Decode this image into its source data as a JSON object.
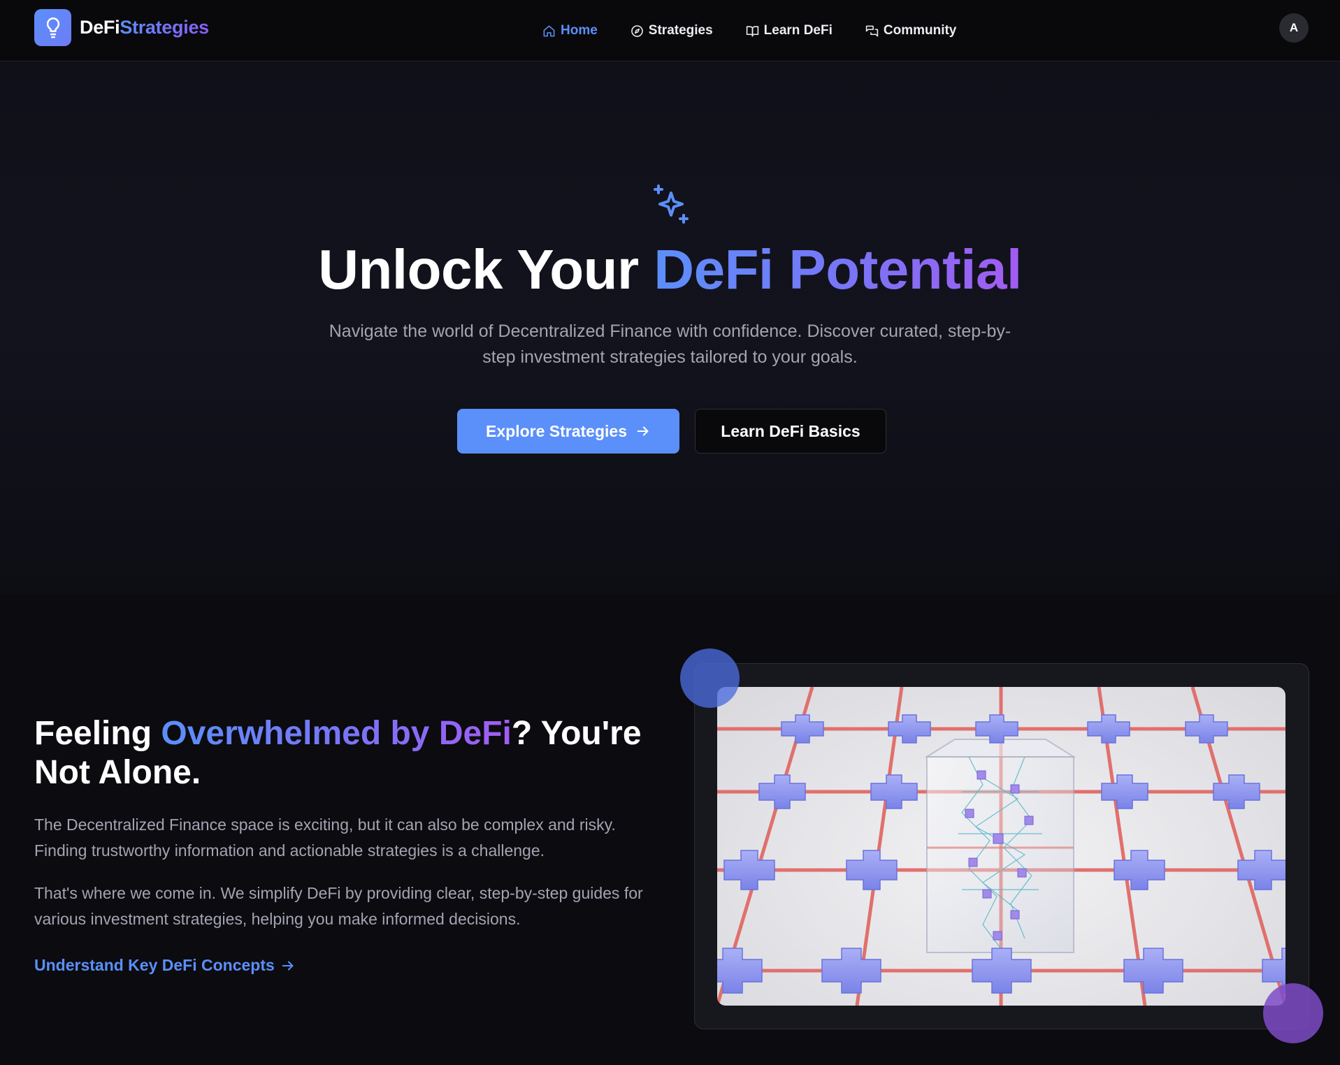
{
  "nav": {
    "brand_part1": "DeFi",
    "brand_part2": "Strategies",
    "brand_icon": "lightbulb-icon",
    "links": [
      {
        "label": "Home",
        "icon": "home-icon",
        "active": true
      },
      {
        "label": "Strategies",
        "icon": "compass-icon",
        "active": false
      },
      {
        "label": "Learn DeFi",
        "icon": "book-open-icon",
        "active": false
      },
      {
        "label": "Community",
        "icon": "chat-bubbles-icon",
        "active": false
      }
    ],
    "avatar_initial": "A"
  },
  "hero": {
    "icon": "sparkles-icon",
    "title_plain": "Unlock Your ",
    "title_highlight": "DeFi Potential",
    "subtitle": "Navigate the world of Decentralized Finance with confidence. Discover curated, step-by-step investment strategies tailored to your goals.",
    "primary_button": "Explore Strategies",
    "secondary_button": "Learn DeFi Basics"
  },
  "intro": {
    "title_part1": "Feeling ",
    "title_highlight": "Overwhelmed by DeFi",
    "title_part2": "? You're Not Alone.",
    "paragraph1": "The Decentralized Finance space is exciting, but it can also be complex and risky. Finding trustworthy information and actionable strategies is a challenge.",
    "paragraph2": "That's where we come in. We simplify DeFi by providing clear, step-by-step guides for various investment strategies, helping you make informed decisions.",
    "link_label": "Understand Key DeFi Concepts",
    "image_subject": "3D network grid illustration with central glass cube"
  },
  "colors": {
    "accent_blue": "#5b8ff9",
    "accent_purple": "#a35cf2",
    "background": "#0b0b10",
    "nav_background": "#09090c"
  }
}
